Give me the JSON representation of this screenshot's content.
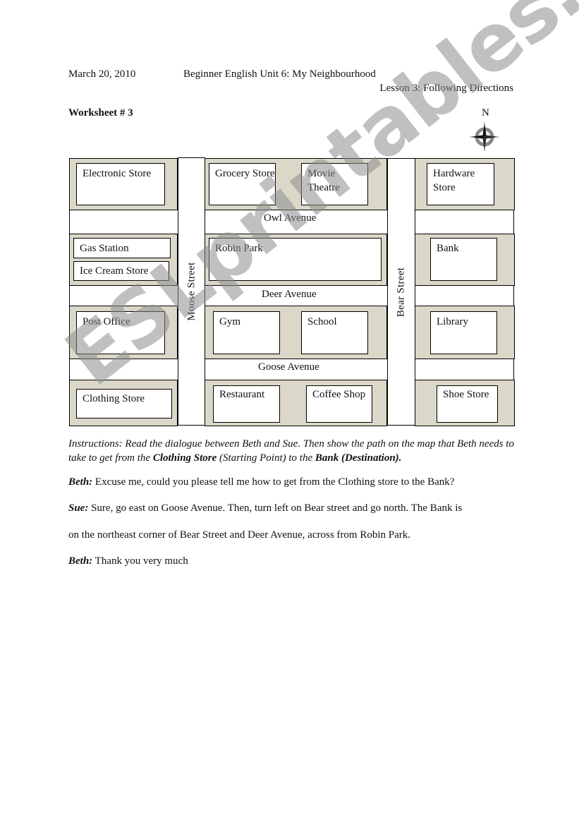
{
  "header": {
    "date": "March 20, 2010",
    "course": "Beginner English  Unit 6:  My Neighbourhood",
    "lesson": "Lesson 3: Following Directions",
    "worksheet": "Worksheet # 3",
    "compass_label": "N",
    "compass_icon": "compass-rose-icon"
  },
  "map": {
    "streets": {
      "moose": "Moose  Street",
      "bear": "Bear Street"
    },
    "avenues": {
      "owl": "Owl Avenue",
      "deer": "Deer Avenue",
      "goose": "Goose Avenue"
    },
    "places": {
      "electronic_store": "Electronic Store",
      "grocery_store": "Grocery Store",
      "movie_theatre": "Movie Theatre",
      "hardware_store": "Hardware Store",
      "gas_station": "Gas Station",
      "ice_cream_store": "Ice Cream Store",
      "robin_park": "Robin Park",
      "bank": "Bank",
      "post_office": "Post Office",
      "gym": "Gym",
      "school": "School",
      "library": "Library",
      "clothing_store": "Clothing Store",
      "restaurant": "Restaurant",
      "coffee_shop": "Coffee Shop",
      "shoe_store": "Shoe Store"
    },
    "block_color": "#dbd8c9"
  },
  "instructions": {
    "part1": "Instructions:  Read the dialogue between Beth and Sue.  Then show the path on the map that Beth needs to take to get from the ",
    "start": "Clothing Store",
    "part2": " (Starting Point) to the ",
    "dest": "Bank",
    "part3": " (Destination)."
  },
  "dialogue": [
    {
      "speaker": "Beth:",
      "text": "  Excuse me, could you please tell me how to get from the Clothing store to the Bank?"
    },
    {
      "speaker": "Sue:",
      "text": "  Sure, go east on Goose Avenue.  Then, turn left on Bear street and go north.  The Bank is"
    },
    {
      "speaker": "",
      "text": "on the northeast corner of Bear Street and Deer Avenue, across from Robin Park."
    },
    {
      "speaker": "Beth:",
      "text": " Thank you very much"
    }
  ],
  "watermark": "ESLprintables.com"
}
